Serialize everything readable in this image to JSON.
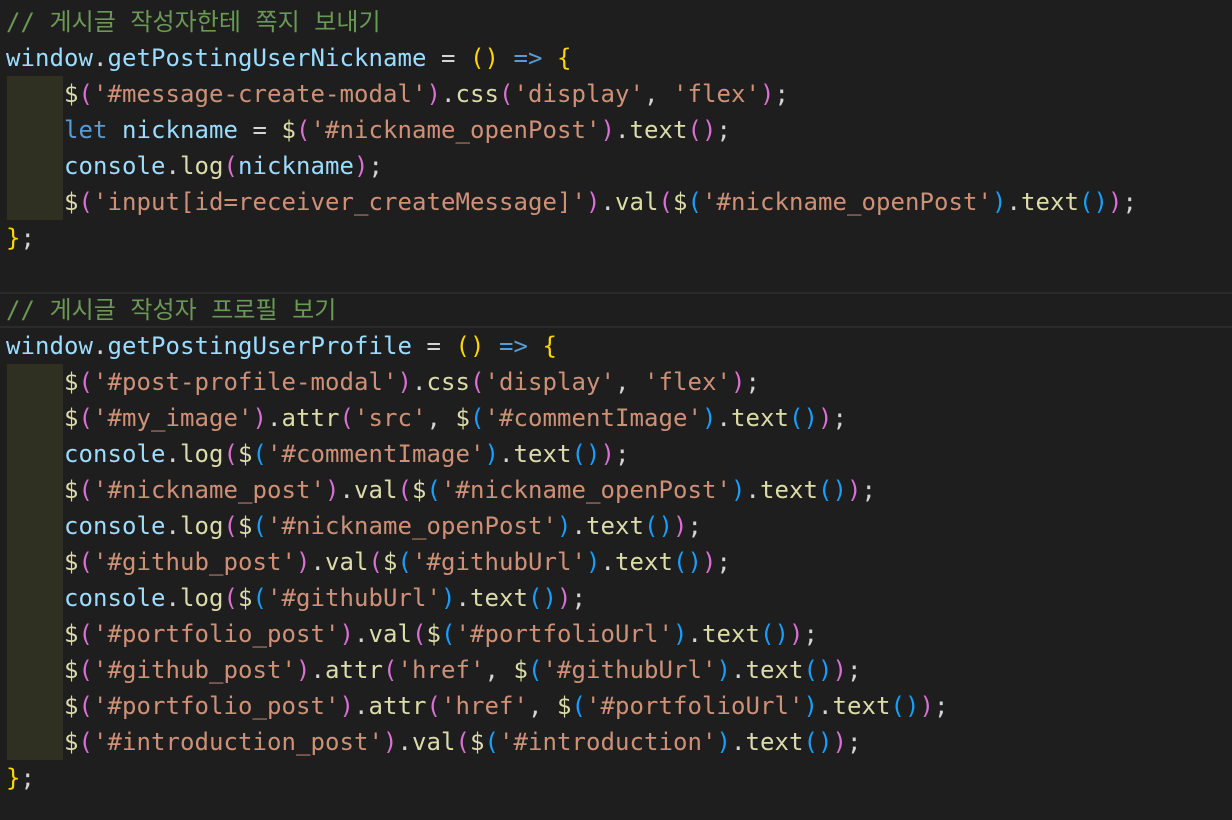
{
  "editor": {
    "language": "javascript",
    "theme": "dark",
    "colors": {
      "background": "#1e1e1e",
      "indent_guide": "#2f2f22",
      "comment": "#6a9955",
      "variable": "#9cdcfe",
      "function": "#dcdcaa",
      "string": "#ce9178",
      "keyword": "#569cd6",
      "bracket_level_1": "#ffd700",
      "bracket_level_2": "#da70d6",
      "bracket_level_3": "#179fff"
    },
    "lines": [
      {
        "indent": 0,
        "tokens": [
          {
            "c": "comment",
            "t": "// 게시글 작성자한테 쪽지 보내기"
          }
        ]
      },
      {
        "indent": 0,
        "tokens": [
          {
            "c": "var",
            "t": "window"
          },
          {
            "c": "op",
            "t": "."
          },
          {
            "c": "var",
            "t": "getPostingUserNickname"
          },
          {
            "c": "op",
            "t": " = "
          },
          {
            "c": "b1",
            "t": "()"
          },
          {
            "c": "kw",
            "t": " => "
          },
          {
            "c": "b1",
            "t": "{"
          }
        ]
      },
      {
        "indent": 1,
        "tokens": [
          {
            "c": "func",
            "t": "$"
          },
          {
            "c": "b2",
            "t": "("
          },
          {
            "c": "str",
            "t": "'#message-create-modal'"
          },
          {
            "c": "b2",
            "t": ")"
          },
          {
            "c": "op",
            "t": "."
          },
          {
            "c": "func",
            "t": "css"
          },
          {
            "c": "b2",
            "t": "("
          },
          {
            "c": "str",
            "t": "'display'"
          },
          {
            "c": "op",
            "t": ", "
          },
          {
            "c": "str",
            "t": "'flex'"
          },
          {
            "c": "b2",
            "t": ")"
          },
          {
            "c": "op",
            "t": ";"
          }
        ]
      },
      {
        "indent": 1,
        "tokens": [
          {
            "c": "kw",
            "t": "let"
          },
          {
            "c": "op",
            "t": " "
          },
          {
            "c": "var",
            "t": "nickname"
          },
          {
            "c": "op",
            "t": " = "
          },
          {
            "c": "func",
            "t": "$"
          },
          {
            "c": "b2",
            "t": "("
          },
          {
            "c": "str",
            "t": "'#nickname_openPost'"
          },
          {
            "c": "b2",
            "t": ")"
          },
          {
            "c": "op",
            "t": "."
          },
          {
            "c": "func",
            "t": "text"
          },
          {
            "c": "b2",
            "t": "()"
          },
          {
            "c": "op",
            "t": ";"
          }
        ]
      },
      {
        "indent": 1,
        "tokens": [
          {
            "c": "var",
            "t": "console"
          },
          {
            "c": "op",
            "t": "."
          },
          {
            "c": "func",
            "t": "log"
          },
          {
            "c": "b2",
            "t": "("
          },
          {
            "c": "var",
            "t": "nickname"
          },
          {
            "c": "b2",
            "t": ")"
          },
          {
            "c": "op",
            "t": ";"
          }
        ]
      },
      {
        "indent": 1,
        "tokens": [
          {
            "c": "func",
            "t": "$"
          },
          {
            "c": "b2",
            "t": "("
          },
          {
            "c": "str",
            "t": "'input[id=receiver_createMessage]'"
          },
          {
            "c": "b2",
            "t": ")"
          },
          {
            "c": "op",
            "t": "."
          },
          {
            "c": "func",
            "t": "val"
          },
          {
            "c": "b2",
            "t": "("
          },
          {
            "c": "func",
            "t": "$"
          },
          {
            "c": "b3",
            "t": "("
          },
          {
            "c": "str",
            "t": "'#nickname_openPost'"
          },
          {
            "c": "b3",
            "t": ")"
          },
          {
            "c": "op",
            "t": "."
          },
          {
            "c": "func",
            "t": "text"
          },
          {
            "c": "b3",
            "t": "()"
          },
          {
            "c": "b2",
            "t": ")"
          },
          {
            "c": "op",
            "t": ";"
          }
        ]
      },
      {
        "indent": 0,
        "tokens": [
          {
            "c": "b1",
            "t": "}"
          },
          {
            "c": "op",
            "t": ";"
          }
        ]
      },
      {
        "indent": 0,
        "tokens": []
      },
      {
        "indent": 0,
        "tokens": [
          {
            "c": "comment",
            "t": "// 게시글 작성자 프로필 보기"
          }
        ]
      },
      {
        "indent": 0,
        "tokens": [
          {
            "c": "var",
            "t": "window"
          },
          {
            "c": "op",
            "t": "."
          },
          {
            "c": "var",
            "t": "getPostingUserProfile"
          },
          {
            "c": "op",
            "t": " = "
          },
          {
            "c": "b1",
            "t": "()"
          },
          {
            "c": "kw",
            "t": " => "
          },
          {
            "c": "b1",
            "t": "{"
          }
        ]
      },
      {
        "indent": 1,
        "tokens": [
          {
            "c": "func",
            "t": "$"
          },
          {
            "c": "b2",
            "t": "("
          },
          {
            "c": "str",
            "t": "'#post-profile-modal'"
          },
          {
            "c": "b2",
            "t": ")"
          },
          {
            "c": "op",
            "t": "."
          },
          {
            "c": "func",
            "t": "css"
          },
          {
            "c": "b2",
            "t": "("
          },
          {
            "c": "str",
            "t": "'display'"
          },
          {
            "c": "op",
            "t": ", "
          },
          {
            "c": "str",
            "t": "'flex'"
          },
          {
            "c": "b2",
            "t": ")"
          },
          {
            "c": "op",
            "t": ";"
          }
        ]
      },
      {
        "indent": 1,
        "tokens": [
          {
            "c": "func",
            "t": "$"
          },
          {
            "c": "b2",
            "t": "("
          },
          {
            "c": "str",
            "t": "'#my_image'"
          },
          {
            "c": "b2",
            "t": ")"
          },
          {
            "c": "op",
            "t": "."
          },
          {
            "c": "func",
            "t": "attr"
          },
          {
            "c": "b2",
            "t": "("
          },
          {
            "c": "str",
            "t": "'src'"
          },
          {
            "c": "op",
            "t": ", "
          },
          {
            "c": "func",
            "t": "$"
          },
          {
            "c": "b3",
            "t": "("
          },
          {
            "c": "str",
            "t": "'#commentImage'"
          },
          {
            "c": "b3",
            "t": ")"
          },
          {
            "c": "op",
            "t": "."
          },
          {
            "c": "func",
            "t": "text"
          },
          {
            "c": "b3",
            "t": "()"
          },
          {
            "c": "b2",
            "t": ")"
          },
          {
            "c": "op",
            "t": ";"
          }
        ]
      },
      {
        "indent": 1,
        "tokens": [
          {
            "c": "var",
            "t": "console"
          },
          {
            "c": "op",
            "t": "."
          },
          {
            "c": "func",
            "t": "log"
          },
          {
            "c": "b2",
            "t": "("
          },
          {
            "c": "func",
            "t": "$"
          },
          {
            "c": "b3",
            "t": "("
          },
          {
            "c": "str",
            "t": "'#commentImage'"
          },
          {
            "c": "b3",
            "t": ")"
          },
          {
            "c": "op",
            "t": "."
          },
          {
            "c": "func",
            "t": "text"
          },
          {
            "c": "b3",
            "t": "()"
          },
          {
            "c": "b2",
            "t": ")"
          },
          {
            "c": "op",
            "t": ";"
          }
        ]
      },
      {
        "indent": 1,
        "tokens": [
          {
            "c": "func",
            "t": "$"
          },
          {
            "c": "b2",
            "t": "("
          },
          {
            "c": "str",
            "t": "'#nickname_post'"
          },
          {
            "c": "b2",
            "t": ")"
          },
          {
            "c": "op",
            "t": "."
          },
          {
            "c": "func",
            "t": "val"
          },
          {
            "c": "b2",
            "t": "("
          },
          {
            "c": "func",
            "t": "$"
          },
          {
            "c": "b3",
            "t": "("
          },
          {
            "c": "str",
            "t": "'#nickname_openPost'"
          },
          {
            "c": "b3",
            "t": ")"
          },
          {
            "c": "op",
            "t": "."
          },
          {
            "c": "func",
            "t": "text"
          },
          {
            "c": "b3",
            "t": "()"
          },
          {
            "c": "b2",
            "t": ")"
          },
          {
            "c": "op",
            "t": ";"
          }
        ]
      },
      {
        "indent": 1,
        "tokens": [
          {
            "c": "var",
            "t": "console"
          },
          {
            "c": "op",
            "t": "."
          },
          {
            "c": "func",
            "t": "log"
          },
          {
            "c": "b2",
            "t": "("
          },
          {
            "c": "func",
            "t": "$"
          },
          {
            "c": "b3",
            "t": "("
          },
          {
            "c": "str",
            "t": "'#nickname_openPost'"
          },
          {
            "c": "b3",
            "t": ")"
          },
          {
            "c": "op",
            "t": "."
          },
          {
            "c": "func",
            "t": "text"
          },
          {
            "c": "b3",
            "t": "()"
          },
          {
            "c": "b2",
            "t": ")"
          },
          {
            "c": "op",
            "t": ";"
          }
        ]
      },
      {
        "indent": 1,
        "tokens": [
          {
            "c": "func",
            "t": "$"
          },
          {
            "c": "b2",
            "t": "("
          },
          {
            "c": "str",
            "t": "'#github_post'"
          },
          {
            "c": "b2",
            "t": ")"
          },
          {
            "c": "op",
            "t": "."
          },
          {
            "c": "func",
            "t": "val"
          },
          {
            "c": "b2",
            "t": "("
          },
          {
            "c": "func",
            "t": "$"
          },
          {
            "c": "b3",
            "t": "("
          },
          {
            "c": "str",
            "t": "'#githubUrl'"
          },
          {
            "c": "b3",
            "t": ")"
          },
          {
            "c": "op",
            "t": "."
          },
          {
            "c": "func",
            "t": "text"
          },
          {
            "c": "b3",
            "t": "()"
          },
          {
            "c": "b2",
            "t": ")"
          },
          {
            "c": "op",
            "t": ";"
          }
        ]
      },
      {
        "indent": 1,
        "tokens": [
          {
            "c": "var",
            "t": "console"
          },
          {
            "c": "op",
            "t": "."
          },
          {
            "c": "func",
            "t": "log"
          },
          {
            "c": "b2",
            "t": "("
          },
          {
            "c": "func",
            "t": "$"
          },
          {
            "c": "b3",
            "t": "("
          },
          {
            "c": "str",
            "t": "'#githubUrl'"
          },
          {
            "c": "b3",
            "t": ")"
          },
          {
            "c": "op",
            "t": "."
          },
          {
            "c": "func",
            "t": "text"
          },
          {
            "c": "b3",
            "t": "()"
          },
          {
            "c": "b2",
            "t": ")"
          },
          {
            "c": "op",
            "t": ";"
          }
        ]
      },
      {
        "indent": 1,
        "tokens": [
          {
            "c": "func",
            "t": "$"
          },
          {
            "c": "b2",
            "t": "("
          },
          {
            "c": "str",
            "t": "'#portfolio_post'"
          },
          {
            "c": "b2",
            "t": ")"
          },
          {
            "c": "op",
            "t": "."
          },
          {
            "c": "func",
            "t": "val"
          },
          {
            "c": "b2",
            "t": "("
          },
          {
            "c": "func",
            "t": "$"
          },
          {
            "c": "b3",
            "t": "("
          },
          {
            "c": "str",
            "t": "'#portfolioUrl'"
          },
          {
            "c": "b3",
            "t": ")"
          },
          {
            "c": "op",
            "t": "."
          },
          {
            "c": "func",
            "t": "text"
          },
          {
            "c": "b3",
            "t": "()"
          },
          {
            "c": "b2",
            "t": ")"
          },
          {
            "c": "op",
            "t": ";"
          }
        ]
      },
      {
        "indent": 1,
        "tokens": [
          {
            "c": "func",
            "t": "$"
          },
          {
            "c": "b2",
            "t": "("
          },
          {
            "c": "str",
            "t": "'#github_post'"
          },
          {
            "c": "b2",
            "t": ")"
          },
          {
            "c": "op",
            "t": "."
          },
          {
            "c": "func",
            "t": "attr"
          },
          {
            "c": "b2",
            "t": "("
          },
          {
            "c": "str",
            "t": "'href'"
          },
          {
            "c": "op",
            "t": ", "
          },
          {
            "c": "func",
            "t": "$"
          },
          {
            "c": "b3",
            "t": "("
          },
          {
            "c": "str",
            "t": "'#githubUrl'"
          },
          {
            "c": "b3",
            "t": ")"
          },
          {
            "c": "op",
            "t": "."
          },
          {
            "c": "func",
            "t": "text"
          },
          {
            "c": "b3",
            "t": "()"
          },
          {
            "c": "b2",
            "t": ")"
          },
          {
            "c": "op",
            "t": ";"
          }
        ]
      },
      {
        "indent": 1,
        "tokens": [
          {
            "c": "func",
            "t": "$"
          },
          {
            "c": "b2",
            "t": "("
          },
          {
            "c": "str",
            "t": "'#portfolio_post'"
          },
          {
            "c": "b2",
            "t": ")"
          },
          {
            "c": "op",
            "t": "."
          },
          {
            "c": "func",
            "t": "attr"
          },
          {
            "c": "b2",
            "t": "("
          },
          {
            "c": "str",
            "t": "'href'"
          },
          {
            "c": "op",
            "t": ", "
          },
          {
            "c": "func",
            "t": "$"
          },
          {
            "c": "b3",
            "t": "("
          },
          {
            "c": "str",
            "t": "'#portfolioUrl'"
          },
          {
            "c": "b3",
            "t": ")"
          },
          {
            "c": "op",
            "t": "."
          },
          {
            "c": "func",
            "t": "text"
          },
          {
            "c": "b3",
            "t": "()"
          },
          {
            "c": "b2",
            "t": ")"
          },
          {
            "c": "op",
            "t": ";"
          }
        ]
      },
      {
        "indent": 1,
        "tokens": [
          {
            "c": "func",
            "t": "$"
          },
          {
            "c": "b2",
            "t": "("
          },
          {
            "c": "str",
            "t": "'#introduction_post'"
          },
          {
            "c": "b2",
            "t": ")"
          },
          {
            "c": "op",
            "t": "."
          },
          {
            "c": "func",
            "t": "val"
          },
          {
            "c": "b2",
            "t": "("
          },
          {
            "c": "func",
            "t": "$"
          },
          {
            "c": "b3",
            "t": "("
          },
          {
            "c": "str",
            "t": "'#introduction'"
          },
          {
            "c": "b3",
            "t": ")"
          },
          {
            "c": "op",
            "t": "."
          },
          {
            "c": "func",
            "t": "text"
          },
          {
            "c": "b3",
            "t": "()"
          },
          {
            "c": "b2",
            "t": ")"
          },
          {
            "c": "op",
            "t": ";"
          }
        ]
      },
      {
        "indent": 0,
        "tokens": [
          {
            "c": "b1",
            "t": "}"
          },
          {
            "c": "op",
            "t": ";"
          }
        ]
      }
    ]
  }
}
